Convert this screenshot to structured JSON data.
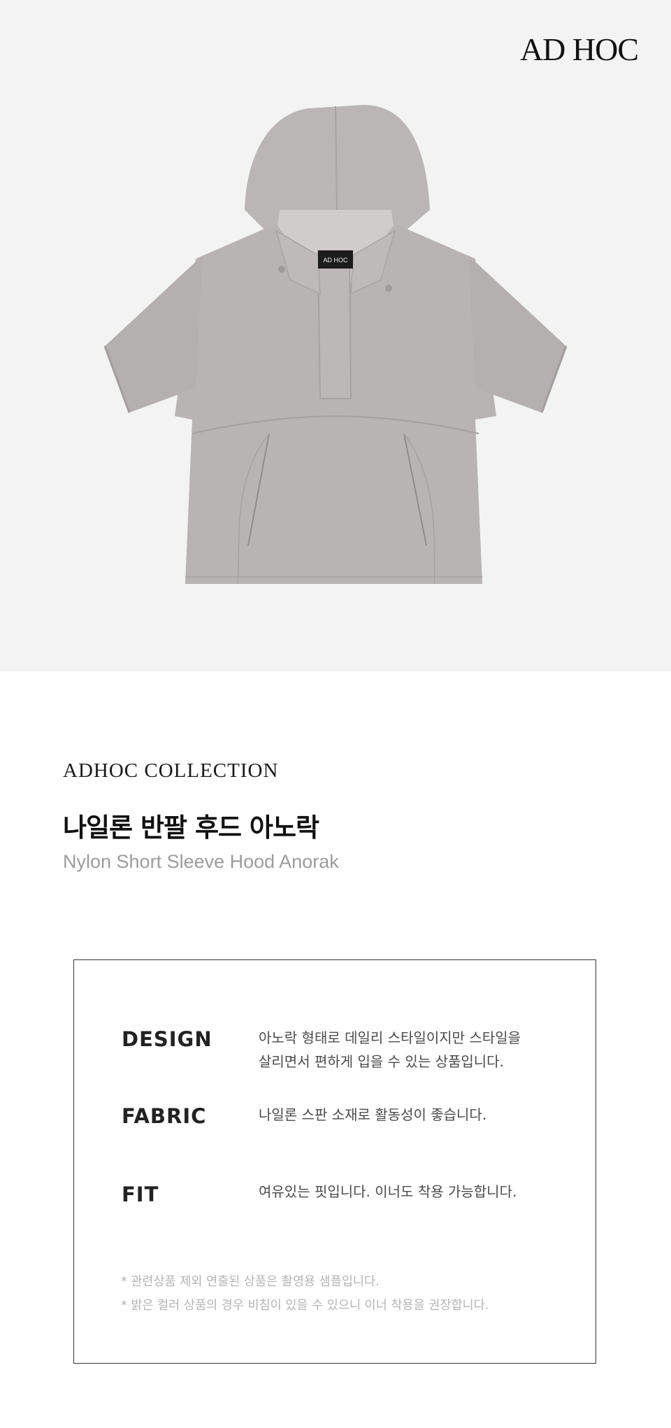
{
  "brand": {
    "logo_text": "AD HOC",
    "label_text": "AD HOC"
  },
  "hero": {
    "background": "#f3f3f3",
    "garment_color": "#b7b4b3"
  },
  "collection": {
    "label": "ADHOC COLLECTION"
  },
  "product": {
    "name_ko": "나일론 반팔 후드 아노락",
    "name_en": "Nylon Short Sleeve Hood Anorak"
  },
  "specs": [
    {
      "key": "DESIGN",
      "lines": [
        "아노락 형태로 데일리 스타일이지만 스타일을",
        "살리면서 편하게 입을 수 있는 상품입니다."
      ]
    },
    {
      "key": "FABRIC",
      "lines": [
        "나일론 스판 소재로 활동성이 좋습니다."
      ]
    },
    {
      "key": "FIT",
      "lines": [
        "여유있는 핏입니다. 이너도 착용 가능합니다."
      ]
    }
  ],
  "notes": [
    "* 관련상품 제외 연출된 상품은 촬영용 샘플입니다.",
    "* 밝은 컬러 상품의 경우 비침이 있을 수 있으니 이너 착용을 권장합니다."
  ]
}
